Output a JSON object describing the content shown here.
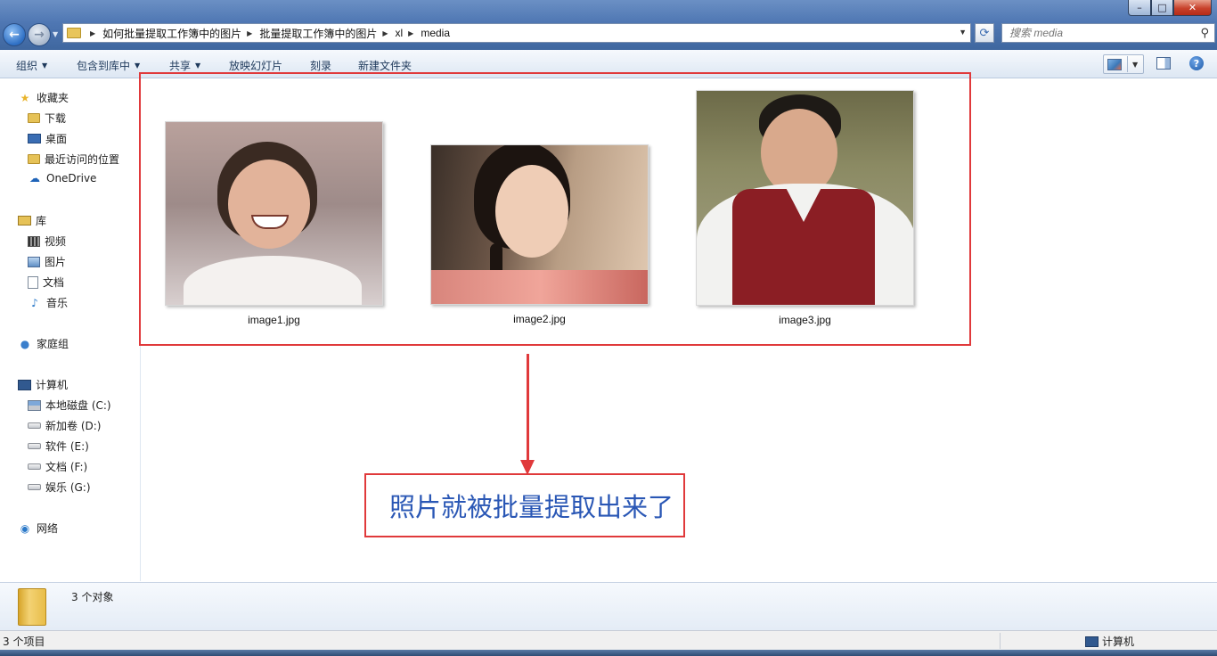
{
  "window": {
    "ghost_title": "",
    "controls": {
      "minimize": "–",
      "maximize": "□",
      "close": "✕"
    }
  },
  "address": {
    "crumbs": [
      "如何批量提取工作簿中的图片",
      "批量提取工作簿中的图片",
      "xl",
      "media"
    ],
    "search_placeholder": "搜索 media"
  },
  "toolbar": {
    "organize": "组织",
    "include_library": "包含到库中",
    "share": "共享",
    "slideshow": "放映幻灯片",
    "burn": "刻录",
    "new_folder": "新建文件夹"
  },
  "sidebar": {
    "favorites": {
      "label": "收藏夹",
      "items": [
        "下载",
        "桌面",
        "最近访问的位置",
        "OneDrive"
      ]
    },
    "libraries": {
      "label": "库",
      "items": [
        "视频",
        "图片",
        "文档",
        "音乐"
      ]
    },
    "homegroup": "家庭组",
    "computer": {
      "label": "计算机",
      "items": [
        "本地磁盘 (C:)",
        "新加卷 (D:)",
        "软件 (E:)",
        "文档 (F:)",
        "娱乐 (G:)"
      ]
    },
    "network": "网络"
  },
  "files": [
    {
      "name": "image1.jpg"
    },
    {
      "name": "image2.jpg"
    },
    {
      "name": "image3.jpg"
    }
  ],
  "annotation": {
    "text": "照片就被批量提取出来了",
    "color": "#e0393b",
    "text_color": "#2a57b5"
  },
  "details": {
    "count": "3 个对象"
  },
  "status": {
    "left": "3 个项目",
    "right": "计算机"
  }
}
